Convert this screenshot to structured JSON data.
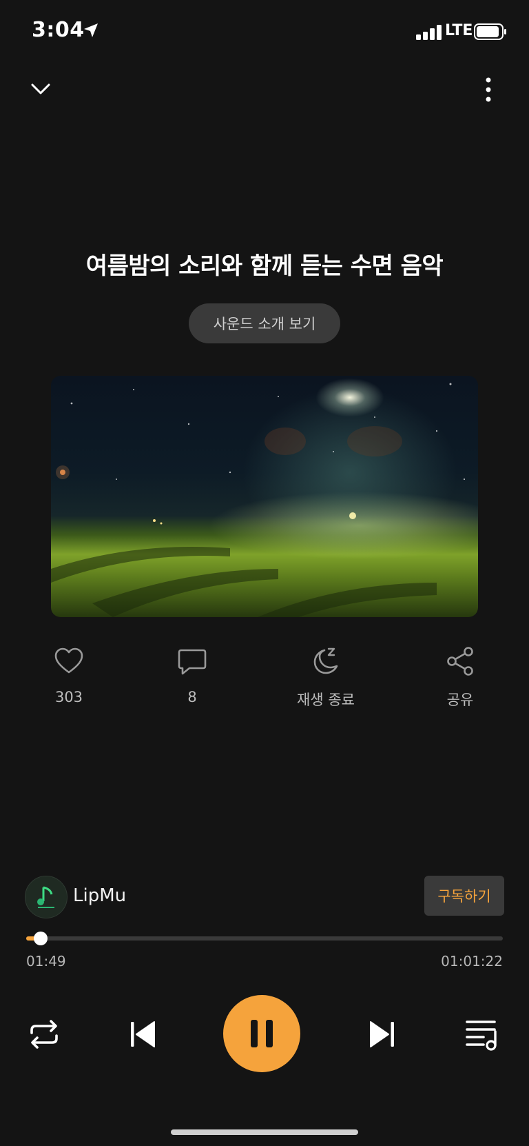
{
  "status_bar": {
    "time": "3:04",
    "network": "LTE"
  },
  "track": {
    "title": "여름밤의 소리와 함께 듣는 수면 음악",
    "intro_button": "사운드 소개 보기"
  },
  "actions": {
    "likes": "303",
    "comments": "8",
    "sleep_timer": "재생 종료",
    "share": "공유"
  },
  "channel": {
    "name": "LipMu",
    "subscribe_label": "구독하기"
  },
  "playback": {
    "current_time": "01:49",
    "total_time": "01:01:22",
    "progress": 0.0297,
    "state": "playing"
  },
  "colors": {
    "accent": "#f5a33c",
    "background": "#141414"
  },
  "icons": [
    "location-arrow-icon",
    "signal-icon",
    "battery-icon",
    "chevron-down-icon",
    "more-vertical-icon",
    "heart-icon",
    "comment-icon",
    "sleep-moon-icon",
    "share-icon",
    "repeat-icon",
    "previous-icon",
    "pause-icon",
    "next-icon",
    "playlist-icon"
  ]
}
